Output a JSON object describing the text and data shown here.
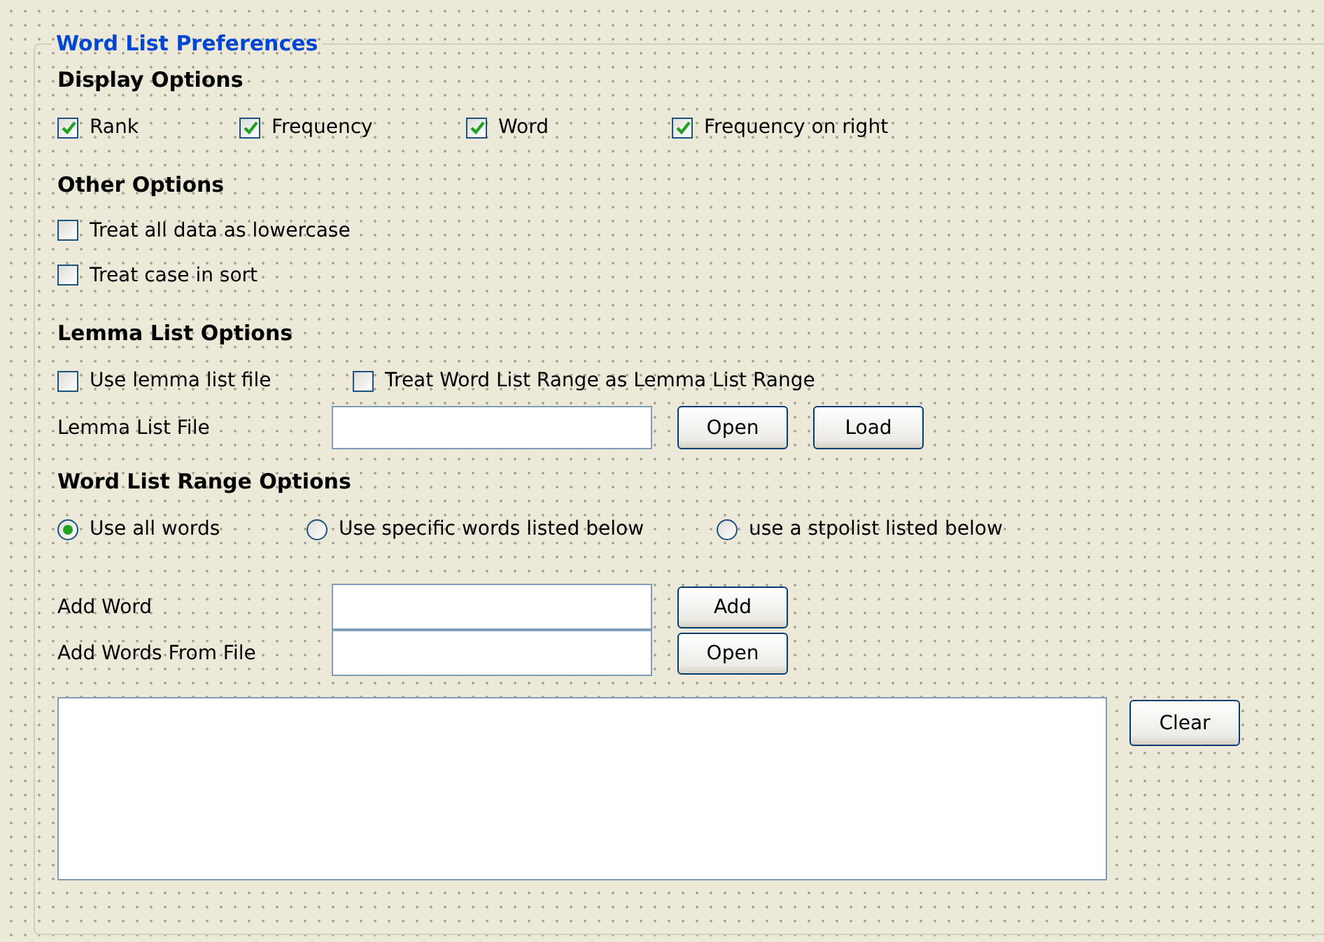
{
  "group": {
    "title": "Word List Preferences"
  },
  "display_options": {
    "heading": "Display Options",
    "checkboxes": [
      {
        "label": "Rank",
        "checked": true
      },
      {
        "label": "Frequency",
        "checked": true
      },
      {
        "label": "Word",
        "checked": true
      },
      {
        "label": "Frequency on right",
        "checked": true
      }
    ]
  },
  "other_options": {
    "heading": "Other Options",
    "checkboxes": [
      {
        "label": "Treat all data as lowercase",
        "checked": false
      },
      {
        "label": "Treat case in sort",
        "checked": false
      }
    ]
  },
  "lemma_list_options": {
    "heading": "Lemma List Options",
    "checkboxes": [
      {
        "label": "Use lemma list file",
        "checked": false
      },
      {
        "label": "Treat Word List Range as Lemma List Range",
        "checked": false
      }
    ],
    "file_label": "Lemma List File",
    "buttons": [
      "Open",
      "Load"
    ]
  },
  "word_list_range_options": {
    "heading": "Word List Range Options",
    "radios": [
      {
        "label": "Use all words",
        "selected": true
      },
      {
        "label": "Use specific words listed below",
        "selected": false
      },
      {
        "label": "use a stpolist listed below",
        "selected": false
      }
    ],
    "add_word": {
      "label": "Add Word",
      "button": "Add"
    },
    "add_words_from_file": {
      "label": "Add Words From File",
      "button": "Open"
    },
    "clear_button": "Clear"
  }
}
